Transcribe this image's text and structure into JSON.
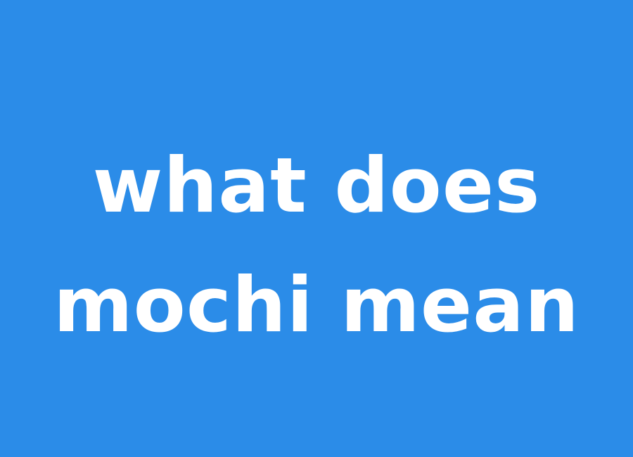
{
  "colors": {
    "background": "#2b8ce8",
    "text": "#ffffff"
  },
  "headline": {
    "line1": "what does",
    "line2": "mochi mean"
  }
}
